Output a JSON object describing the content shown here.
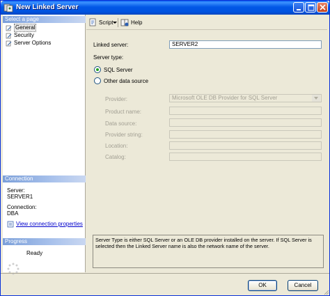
{
  "window": {
    "title": "New Linked Server"
  },
  "left_panel": {
    "select_page_header": "Select a page",
    "pages": [
      {
        "label": "General",
        "icon": "page-icon",
        "selected": true
      },
      {
        "label": "Security",
        "icon": "page-icon",
        "selected": false
      },
      {
        "label": "Server Options",
        "icon": "page-icon",
        "selected": false
      }
    ],
    "connection_header": "Connection",
    "server_label": "Server:",
    "server_value": "SERVER1",
    "connection_label": "Connection:",
    "connection_value": "DBA",
    "view_properties_link": "View connection properties",
    "progress_header": "Progress",
    "progress_status": "Ready"
  },
  "toolbar": {
    "script_label": "Script",
    "help_label": "Help"
  },
  "form": {
    "linked_server_label": "Linked server:",
    "linked_server_value": "SERVER2",
    "server_type_label": "Server type:",
    "radio_sql_server": "SQL Server",
    "radio_other": "Other data source",
    "selected_server_type": "SQL Server",
    "provider_label": "Provider:",
    "provider_value": "Microsoft OLE DB Provider for SQL Server",
    "product_name_label": "Product name:",
    "data_source_label": "Data source:",
    "provider_string_label": "Provider string:",
    "location_label": "Location:",
    "catalog_label": "Catalog:"
  },
  "description": "Server Type is either SQL Server or an OLE DB provider installed on the server. If SQL Server is selected then the Linked Server name is also the network name of the server.",
  "buttons": {
    "ok": "OK",
    "cancel": "Cancel"
  },
  "colors": {
    "titlebar": "#0258e6",
    "panel_header": "#7b9fd9",
    "dialog_bg": "#ece9d8",
    "link": "#0000cc"
  }
}
